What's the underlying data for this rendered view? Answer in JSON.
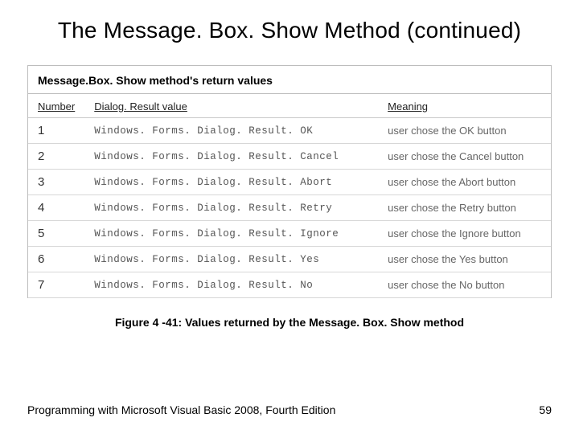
{
  "title": "The Message. Box. Show Method (continued)",
  "panel_title": "Message.Box. Show method's return values",
  "columns": {
    "c1": "Number",
    "c2": "Dialog. Result value",
    "c3": "Meaning"
  },
  "rows": [
    {
      "n": "1",
      "v": "Windows. Forms. Dialog. Result. OK",
      "m": "user chose the OK button"
    },
    {
      "n": "2",
      "v": "Windows. Forms. Dialog. Result. Cancel",
      "m": "user chose the Cancel button"
    },
    {
      "n": "3",
      "v": "Windows. Forms. Dialog. Result. Abort",
      "m": "user chose the Abort button"
    },
    {
      "n": "4",
      "v": "Windows. Forms. Dialog. Result. Retry",
      "m": "user chose the Retry button"
    },
    {
      "n": "5",
      "v": "Windows. Forms. Dialog. Result. Ignore",
      "m": "user chose the Ignore button"
    },
    {
      "n": "6",
      "v": "Windows. Forms. Dialog. Result. Yes",
      "m": "user chose the Yes button"
    },
    {
      "n": "7",
      "v": "Windows. Forms. Dialog. Result. No",
      "m": "user chose the No button"
    }
  ],
  "caption": "Figure 4 -41: Values returned by the Message. Box. Show method",
  "footer_book": "Programming with Microsoft Visual Basic 2008, Fourth Edition",
  "footer_page": "59"
}
